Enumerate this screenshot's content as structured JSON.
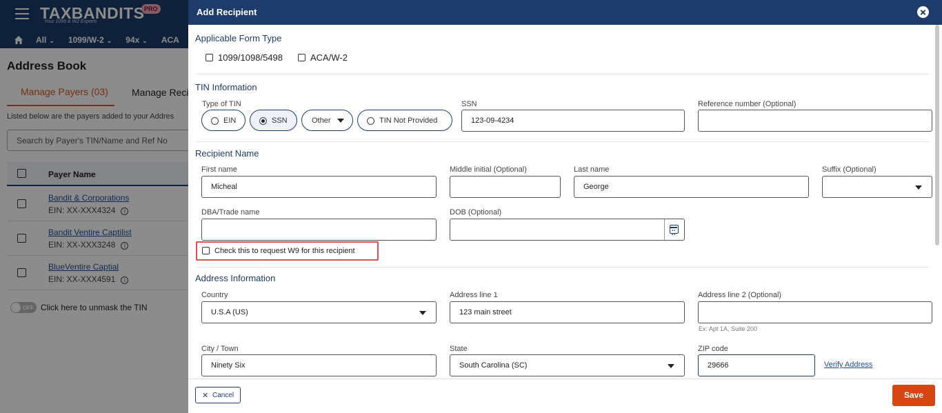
{
  "app": {
    "logo_text": "TAXBANDITS",
    "logo_reg": "®",
    "logo_tagline": "Your 1099 & W2 Experts",
    "pro_badge": "PRO",
    "nav": [
      "All",
      "1099/W-2",
      "94x",
      "ACA"
    ]
  },
  "address_book": {
    "title": "Address Book",
    "tabs": [
      "Manage Payers (03)",
      "Manage Recip"
    ],
    "listed_text": "Listed below are the payers added to your Addres",
    "search_placeholder": "Search by Payer's TIN/Name and Ref No",
    "column_header": "Payer Name",
    "payers": [
      {
        "name": "Bandit & Corporations",
        "ein": "EIN: XX-XXX4324"
      },
      {
        "name": "Bandit Ventire Captilist",
        "ein": "EIN: XX-XXX3248"
      },
      {
        "name": "BlueVentire Captial",
        "ein": "EIN: XX-XXX4591"
      }
    ],
    "toggle_label": "OFF",
    "unmask_text": "Click here to unmask the TIN"
  },
  "drawer": {
    "title": "Add Recipient",
    "form_type": {
      "title": "Applicable Form Type",
      "options": [
        "1099/1098/5498",
        "ACA/W-2"
      ]
    },
    "tin": {
      "title": "TIN Information",
      "type_label": "Type of TIN",
      "types": [
        "EIN",
        "SSN",
        "Other",
        "TIN Not Provided"
      ],
      "selected_type": "SSN",
      "ssn_label": "SSN",
      "ssn_value": "123-09-4234",
      "ref_label": "Reference number (Optional)",
      "ref_value": ""
    },
    "name": {
      "title": "Recipient Name",
      "first_label": "First name",
      "first_value": "Micheal",
      "middle_label": "Middle initial (Optional)",
      "middle_value": "",
      "last_label": "Last name",
      "last_value": "George",
      "suffix_label": "Suffix (Optional)",
      "suffix_value": "",
      "dba_label": "DBA/Trade name",
      "dba_value": "",
      "dob_label": "DOB (Optional)",
      "dob_value": "",
      "w9_label": "Check this to request W9 for this recipient"
    },
    "address": {
      "title": "Address Information",
      "country_label": "Country",
      "country_value": "U.S.A (US)",
      "line1_label": "Address line 1",
      "line1_value": "123 main street",
      "line2_label": "Address line 2 (Optional)",
      "line2_value": "",
      "line2_helper": "Ex: Apt 1A, Suite 200",
      "city_label": "City / Town",
      "city_value": "Ninety Six",
      "state_label": "State",
      "state_value": "South Carolina (SC)",
      "zip_label": "ZIP code",
      "zip_value": "29666",
      "verify_link": "Verify Address"
    },
    "footer": {
      "cancel_label": "Cancel",
      "save_label": "Save"
    }
  },
  "colors": {
    "header": "#1d3c6b",
    "accent": "#d44712",
    "highlight": "#e04b4b"
  }
}
